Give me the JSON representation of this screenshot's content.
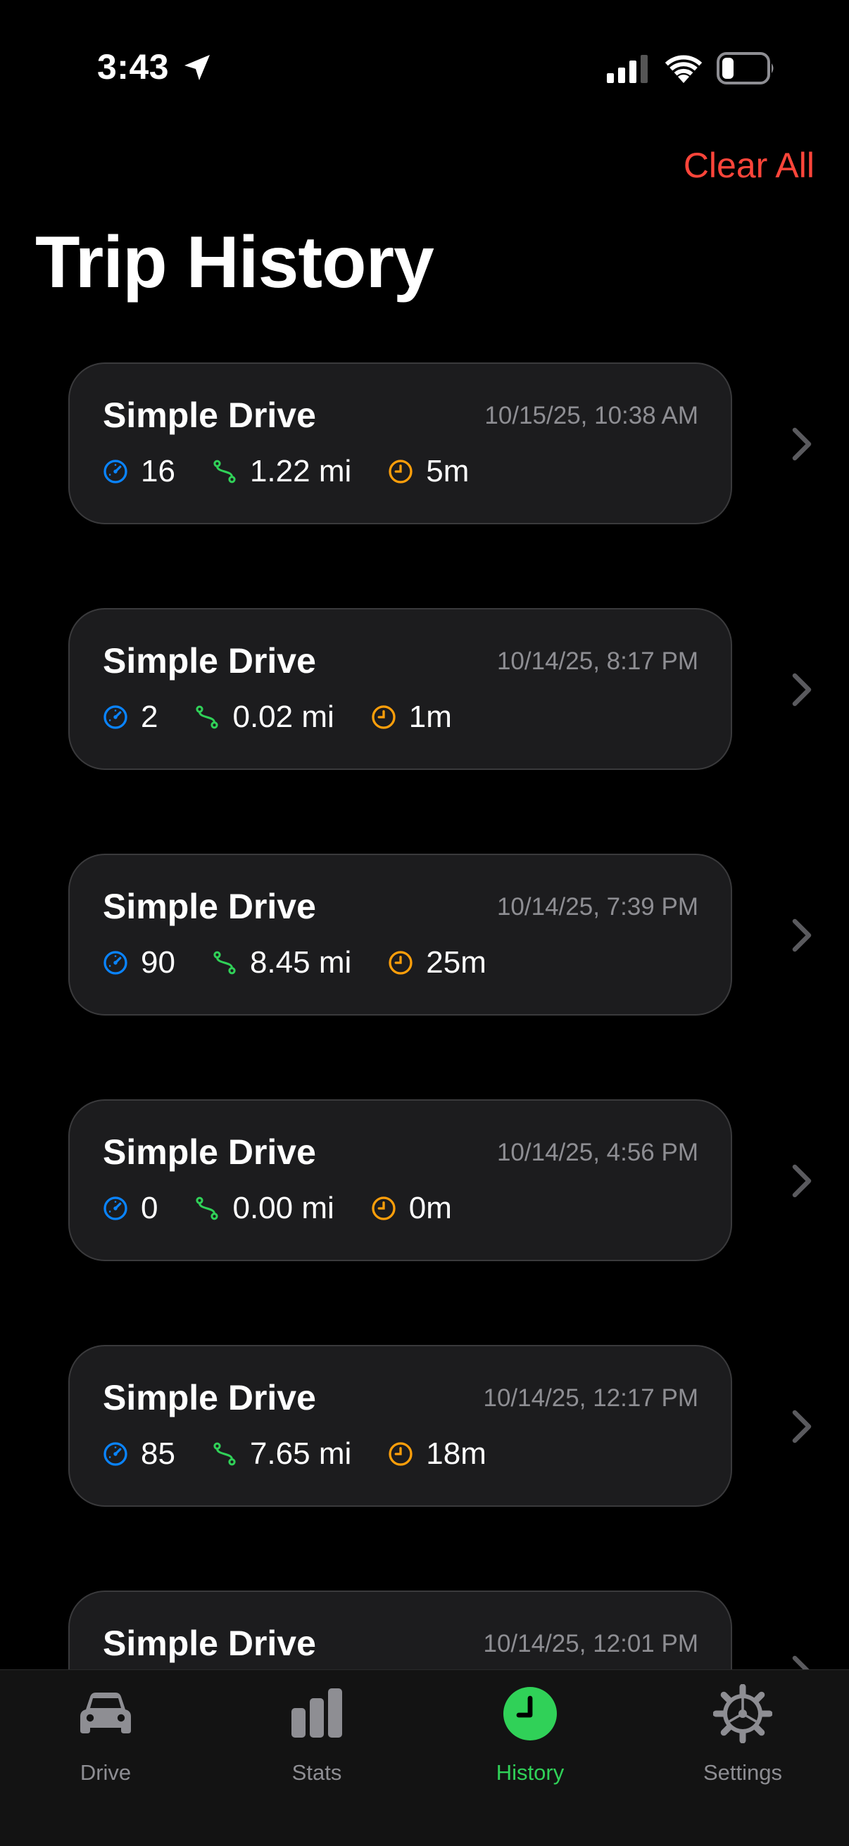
{
  "status_bar": {
    "time": "3:43"
  },
  "header": {
    "clear_all_label": "Clear All",
    "title": "Trip History"
  },
  "trips": [
    {
      "title": "Simple Drive",
      "date": "10/15/25, 10:38 AM",
      "speed": "16",
      "distance": "1.22 mi",
      "duration": "5m"
    },
    {
      "title": "Simple Drive",
      "date": "10/14/25, 8:17 PM",
      "speed": "2",
      "distance": "0.02 mi",
      "duration": "1m"
    },
    {
      "title": "Simple Drive",
      "date": "10/14/25, 7:39 PM",
      "speed": "90",
      "distance": "8.45 mi",
      "duration": "25m"
    },
    {
      "title": "Simple Drive",
      "date": "10/14/25, 4:56 PM",
      "speed": "0",
      "distance": "0.00 mi",
      "duration": "0m"
    },
    {
      "title": "Simple Drive",
      "date": "10/14/25, 12:17 PM",
      "speed": "85",
      "distance": "7.65 mi",
      "duration": "18m"
    },
    {
      "title": "Simple Drive",
      "date": "10/14/25, 12:01 PM"
    }
  ],
  "tab_bar": {
    "tabs": [
      {
        "label": "Drive",
        "icon": "car-icon"
      },
      {
        "label": "Stats",
        "icon": "chart-bars-icon"
      },
      {
        "label": "History",
        "icon": "clock-icon",
        "active": true
      },
      {
        "label": "Settings",
        "icon": "gear-icon"
      }
    ]
  },
  "colors": {
    "accent": "#30d158",
    "destructive": "#ff453a",
    "speed_icon": "#0a84ff",
    "distance_icon": "#30d158",
    "duration_icon": "#ff9f0a"
  }
}
